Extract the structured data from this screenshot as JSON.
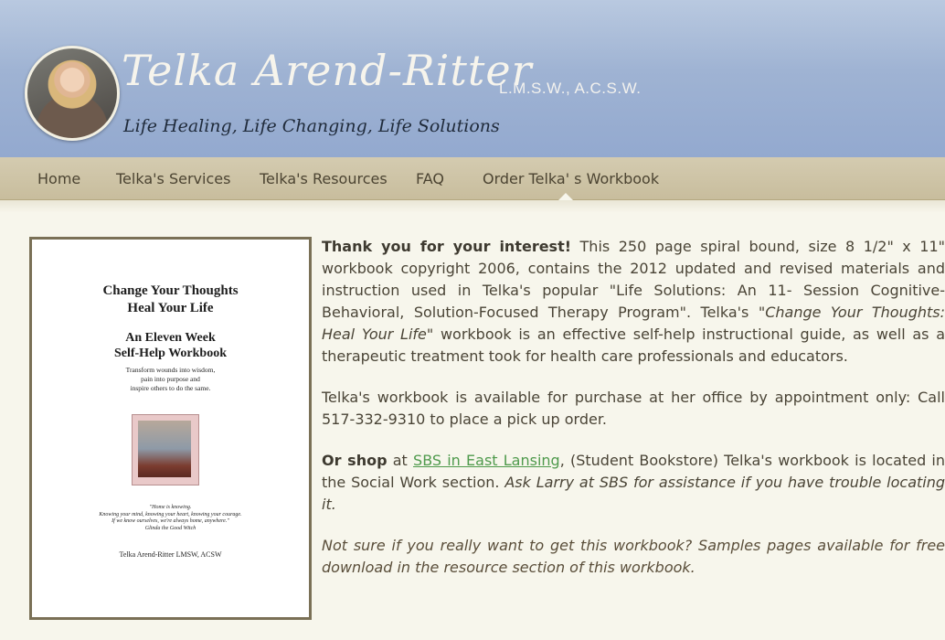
{
  "header": {
    "site_title": "Telka Arend-Ritter",
    "credentials": "L.M.S.W., A.C.S.W.",
    "tagline": "Life Healing, Life Changing, Life Solutions"
  },
  "nav": {
    "items": [
      {
        "label": "Home"
      },
      {
        "label": "Telka's Services"
      },
      {
        "label": "Telka's Resources"
      },
      {
        "label": "FAQ"
      },
      {
        "label": "Order Telka' s Workbook"
      }
    ]
  },
  "book": {
    "title_line1": "Change Your Thoughts",
    "title_line2": "Heal Your Life",
    "subtitle_line1": "An Eleven Week",
    "subtitle_line2": "Self-Help Workbook",
    "blurb_line1": "Transform wounds into wisdom,",
    "blurb_line2": "pain into purpose and",
    "blurb_line3": "inspire others to do the same.",
    "quote_line1": "\"Home is knowing.",
    "quote_line2": "Knowing your mind, knowing your heart, knowing your courage.",
    "quote_line3": "If we know ourselves, we're always home, anywhere.\"",
    "quote_line4": "Glinda the Good Witch",
    "author": "Telka Arend-Ritter LMSW, ACSW"
  },
  "content": {
    "p1_bold": "Thank you for your interest!",
    "p1_text_a": " This 250 page spiral bound, size 8 1/2\" x 11\" workbook copyright 2006, contains the 2012 updated and revised materials and instruction used in Telka's popular \"Life Solutions: An 11- Session Cognitive-Behavioral, Solution-Focused Therapy Program\". Telka's \"",
    "p1_italic": "Change Your Thoughts: Heal Your Life",
    "p1_text_b": "\" workbook is an effective self-help instructional guide, as well as a therapeutic treatment took for health care professionals and educators.",
    "p2": "Telka's workbook is available for purchase at her office by appointment only: Call 517-332-9310 to place a pick up order.",
    "p3_bold": "Or shop",
    "p3_text_a": " at ",
    "p3_link": "SBS in East Lansing",
    "p3_text_b": ", (Student Bookstore) Telka's workbook is located in the Social Work section. ",
    "p3_italic": "Ask Larry at SBS for assistance if you have trouble locating it.",
    "p4": "Not sure if you really want to get this workbook?  Samples pages available for free download in the resource section of this workbook."
  }
}
